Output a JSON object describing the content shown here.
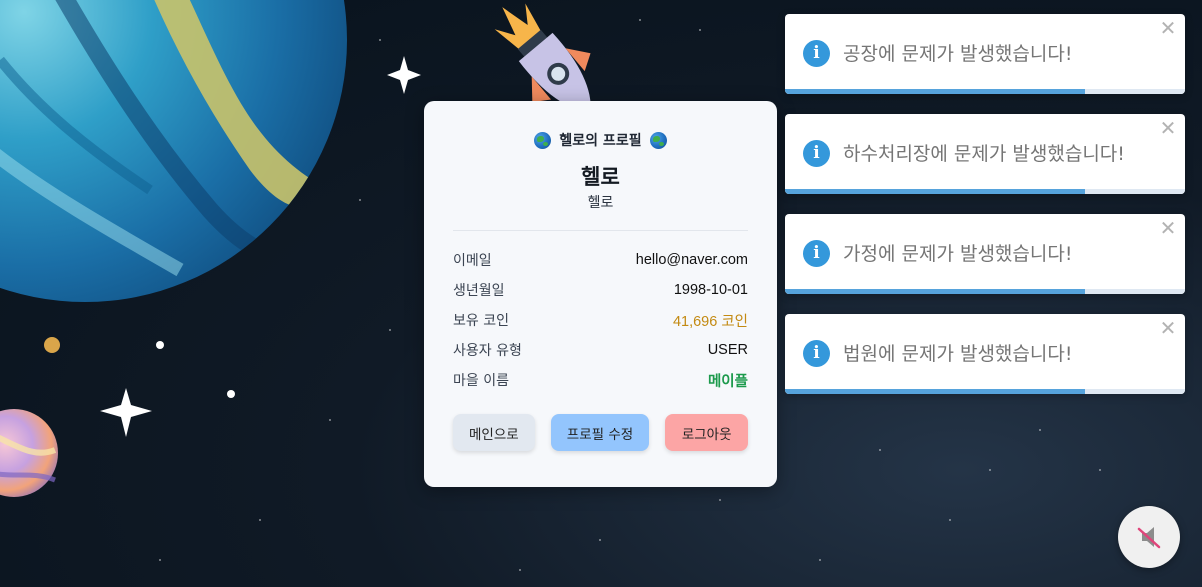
{
  "profile": {
    "heading": "헬로의 프로필",
    "name": "헬로",
    "nickname": "헬로",
    "rows": [
      {
        "label": "이메일",
        "value": "hello@naver.com"
      },
      {
        "label": "생년월일",
        "value": "1998-10-01"
      },
      {
        "label": "보유 코인",
        "value": "41,696 코인"
      },
      {
        "label": "사용자 유형",
        "value": "USER"
      },
      {
        "label": "마을 이름",
        "value": "메이플"
      }
    ],
    "buttons": {
      "main": "메인으로",
      "edit": "프로필 수정",
      "logout": "로그아웃"
    }
  },
  "toasts": [
    {
      "message": "공장에 문제가 발생했습니다!",
      "progress": 0.75
    },
    {
      "message": "하수처리장에 문제가 발생했습니다!",
      "progress": 0.75
    },
    {
      "message": "가정에 문제가 발생했습니다!",
      "progress": 0.75
    },
    {
      "message": "법원에 문제가 발생했습니다!",
      "progress": 0.75
    }
  ],
  "icons": {
    "toast_icon": "info-icon",
    "toast_close": "close-icon",
    "heading_decoration": "globe-icon",
    "mute_button": "speaker-muted-icon"
  },
  "colors": {
    "info": "#3498db",
    "progress": "#56a3dc",
    "coin": "#c38a12",
    "village": "#1c9a4c",
    "edit_button": "#93c5fd",
    "logout_button": "#fca5a5"
  }
}
